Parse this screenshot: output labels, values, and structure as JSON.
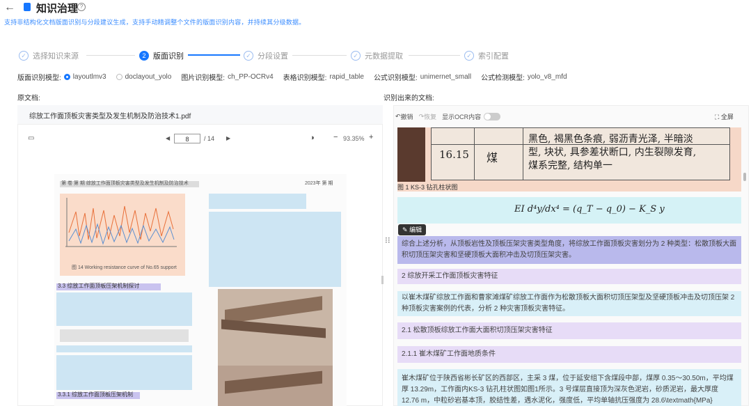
{
  "header": {
    "title": "知识治理",
    "description": "支持非结构化文档版面识别与分段建议生成，支持手动精调整个文件的版面识别内容，并持续其分级数据。"
  },
  "steps": [
    {
      "label": "选择知识来源",
      "num": "1",
      "state": "done"
    },
    {
      "label": "版面识别",
      "num": "2",
      "state": "active"
    },
    {
      "label": "分段设置",
      "num": "3",
      "state": "pending"
    },
    {
      "label": "元数据提取",
      "num": "4",
      "state": "pending"
    },
    {
      "label": "索引配置",
      "num": "5",
      "state": "pending"
    }
  ],
  "models": {
    "layout_label": "版面识别模型:",
    "layout_options": [
      "layoutlmv3",
      "doclayout_yolo"
    ],
    "layout_selected": "layoutlmv3",
    "image_label": "图片识别模型:",
    "image_value": "ch_PP-OCRv4",
    "table_label": "表格识别模型:",
    "table_value": "rapid_table",
    "formula_label": "公式识别模型:",
    "formula_value": "unimernet_small",
    "detect_label": "公式检测模型:",
    "detect_value": "yolo_v8_mfd"
  },
  "source": {
    "label": "原文档:",
    "filename": "综放工作面顶板灾害类型及发生机制及防治技术1.pdf",
    "page_current": "8",
    "page_total": "/ 14",
    "zoom": "93.35%",
    "doc_header_left": "第 卷 第 期 综放工作面顶板灾害类型及发生机制及防治技术",
    "doc_header_right": "2023年 第 期",
    "figure_caption": "图 14 Working resistance curve of No.65 support",
    "chart_labels": {
      "y": "工作阻力/MPa",
      "x": "时间/月-日"
    },
    "section_heading_33": "3.3 综放工作面顶板压架机制探讨",
    "section_heading_331": "3.3.1 综放工作面顶板压架机制"
  },
  "result": {
    "label": "识别出来的文档:",
    "toolbar": {
      "undo": "撤销",
      "redo": "恢复",
      "show_ocr": "显示OCR内容"
    },
    "fullscreen": "全屏",
    "table_depth": "16.15",
    "table_name": "煤",
    "table_desc": "黑色, 褐黑色条痕, 弱沥青光泽, 半暗淡型, 块状, 具参差状断口, 内生裂隙发育, 煤系完整, 结构单一",
    "fig_caption": "图 1 KS-3 钻孔柱状图",
    "formula": "EI d⁴y/dx⁴ = (q_T − q_0) − K_S y",
    "edit_label": "编辑",
    "para1": "综合上述分析，从顶板岩性及顶板压架灾害类型角度，将综放工作面顶板灾害划分为 2 种类型：松散顶板大面积切顶压架灾害和坚硬顶板大面积冲击及切顶压架灾害。",
    "h2": "2 综放开采工作面顶板灾害特征",
    "para2": "以崔木煤矿综放工作面和曹家滩煤矿综放工作面作为松散顶板大面积切顶压架型及坚硬顶板冲击及切顶压架 2 种顶板灾害案例的代表，分析 2 种灾害顶板灾害特征。",
    "h3": "2.1 松散顶板综放工作面大面积切顶压架灾害特征",
    "h4": "2.1.1 崔木煤矿工作面地质条件",
    "para3": "崔木煤矿位于陕西省彬长矿区的西部区，主采 3 煤，位于延安组下含煤段中部，煤厚 0.35～30.50m，平均煤厚 13.29m，工作面内KS-3 钻孔柱状图如图1所示。3 号煤层直接顶为深灰色泥岩，砂质泥岩，最大厚度 12.76 m，中粒砂岩基本顶，胶结性差，遇水泥化，强度低，平均单轴抗压强度为 28.6\\textmath{MPa}"
  }
}
